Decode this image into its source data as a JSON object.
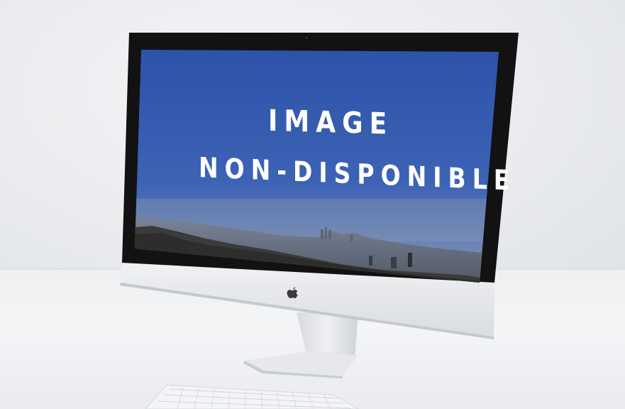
{
  "screen": {
    "message_line1": "IMAGE",
    "message_line2": "NON-DISPONIBLE"
  },
  "icons": {
    "logo": "apple-logo-icon"
  },
  "colors": {
    "sky_top": "#2f55ad",
    "sky_bottom": "#7d8fab",
    "bezel": "#111111",
    "body_silver": "#e2e4e7",
    "message_text": "#ffffff"
  }
}
